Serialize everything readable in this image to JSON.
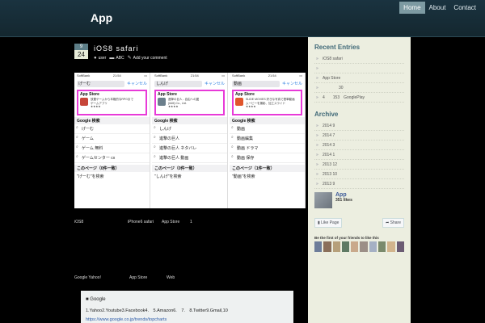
{
  "header": {
    "site_title": "App",
    "nav": [
      {
        "label": "Home",
        "active": true
      },
      {
        "label": "About",
        "active": false
      },
      {
        "label": "Contact",
        "active": false
      }
    ]
  },
  "post": {
    "date_month": "9",
    "date_day": "24",
    "title": "iOS8 safari",
    "meta": {
      "author": "user",
      "category": "ABC",
      "comments": "Add your comment"
    }
  },
  "screenshot": {
    "phones": [
      {
        "carrier": "SoftBank",
        "time": "21:54",
        "battery": "",
        "query": "げーむ",
        "cancel": "キャンセル",
        "store_header": "App Store",
        "app_text": [
          "放置ゲームから本格的なRPGまで",
          "ゲームアプリ",
          "★★★★"
        ],
        "google_header": "Google 検索",
        "suggestions": [
          "げーむ",
          "ゲーム",
          "ゲーム 無料",
          "ゲームセンター cx"
        ],
        "page_header": "このページ（0件一致）",
        "page_search": "\"げーむ\"を検索"
      },
      {
        "carrier": "SoftBank",
        "time": "21:54",
        "battery": "",
        "query": "しんげ",
        "cancel": "キャンセル",
        "store_header": "App Store",
        "app_text": [
          "進撃の巨人 - 自由への翼",
          "(IAM) Co., Ltd.",
          "★★★★"
        ],
        "google_header": "Google 検索",
        "suggestions": [
          "しんげ",
          "進撃の巨人",
          "進撃の巨人 ネタバレ",
          "進撃の巨人 動画"
        ],
        "page_header": "このページ（0件一致）",
        "page_search": "\"しんげ\"を検索"
      },
      {
        "carrier": "SoftBank",
        "time": "21:54",
        "battery": "",
        "query": "動画",
        "cancel": "キャンセル",
        "store_header": "App Store",
        "app_text": [
          "SLIDE MOVIES 好きな写真で簡単動画",
          "ムービーを撮影、加工スライド",
          "★★★★"
        ],
        "google_header": "Google 検索",
        "suggestions": [
          "動画",
          "動画編集",
          "動画 ドラマ",
          "動画 保存"
        ],
        "page_header": "このページ（1件一致）",
        "page_search": "\"動画\"を検索"
      }
    ]
  },
  "body_rows": [
    {
      "a": "iOS8",
      "b": "iPhone6 safari",
      "c": "App Store",
      "d": "1"
    },
    {
      "a": "Google Yahoo!",
      "b": "App Store",
      "c": "Web",
      "d": ""
    }
  ],
  "google_box": {
    "title": "■ Google",
    "list": "1.Yahoo2.Youtube3.Facebook4.　5.Amazon6.　7.　8.Twitter9.Gmail,10",
    "link": "https://www.google.co.jp/trends/topcharts"
  },
  "sidebar": {
    "recent_title": "Recent Entries",
    "recent": [
      "iOS8 safari",
      "",
      "App Store",
      "　　　　30",
      "4　　153　GooglePlay"
    ],
    "archive_title": "Archive",
    "archive": [
      "2014 9",
      "2014 7",
      "2014 3",
      "2014 1",
      "2013 12",
      "2013 10",
      "2013 9"
    ],
    "fb": {
      "name": "App",
      "likes": "351 likes",
      "like_button": "Like Page",
      "share_button": "Share",
      "friends_text": "Be the first of your friends to like this",
      "faces": [
        "#6d7d9a",
        "#8a6f5a",
        "#b6a07a",
        "#5f7a64",
        "#c9a98b",
        "#9c8f87",
        "#a5b0c4",
        "#7a8a6c",
        "#d2b48c",
        "#6b5b73"
      ]
    }
  }
}
